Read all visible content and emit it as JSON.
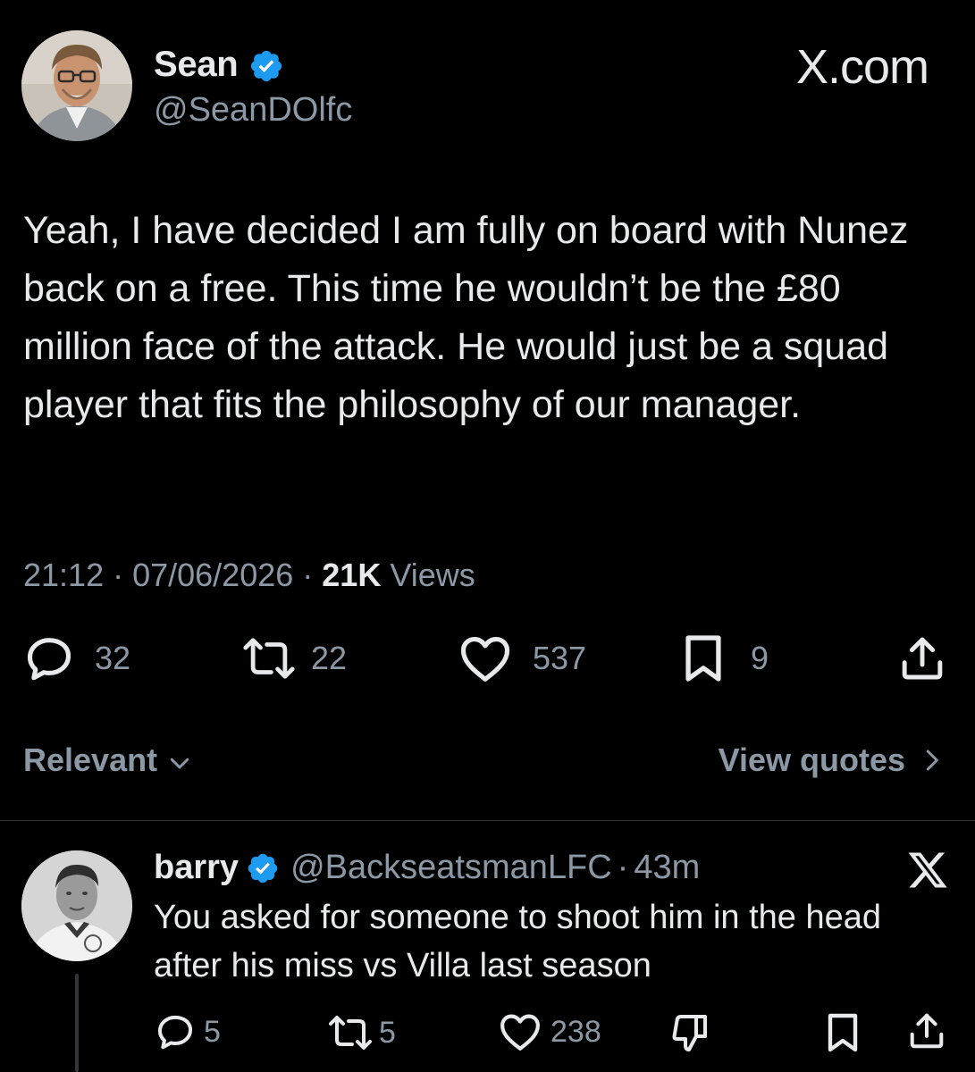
{
  "post": {
    "author_name": "Sean",
    "author_handle": "@SeanDOlfc",
    "brand": "X.com",
    "text": "Yeah, I have decided I am fully on board with Nunez back on a free. This time he wouldn’t be the £80 million face of the attack. He would just be a squad player that fits the philosophy of our manager.",
    "time": "21:12",
    "date": "07/06/2026",
    "views_count": "21K",
    "views_label": "Views",
    "separator": "·",
    "replies": "32",
    "reposts": "22",
    "likes": "537",
    "bookmarks": "9"
  },
  "filter": {
    "sort_label": "Relevant",
    "view_quotes_label": "View quotes"
  },
  "reply": {
    "author_name": "barry",
    "author_handle": "@BackseatsmanLFC",
    "separator": "·",
    "age": "43m",
    "text": "You asked for someone to shoot him in the head after his miss vs Villa last season",
    "replies": "5",
    "reposts": "5",
    "likes": "238"
  },
  "colors": {
    "background": "#000000",
    "primary_text": "#e7e9ea",
    "secondary_text": "#8b98a5",
    "verified_badge": "#1d9bf0",
    "divider": "#2f3336"
  },
  "icons": {
    "verified": "verified-badge-icon",
    "reply": "speech-bubble-icon",
    "repost": "repost-arrows-icon",
    "like": "heart-icon",
    "bookmark": "bookmark-icon",
    "share": "share-upload-icon",
    "dislike": "thumbs-down-icon",
    "chevron_down": "chevron-down-icon",
    "chevron_right": "chevron-right-icon"
  }
}
